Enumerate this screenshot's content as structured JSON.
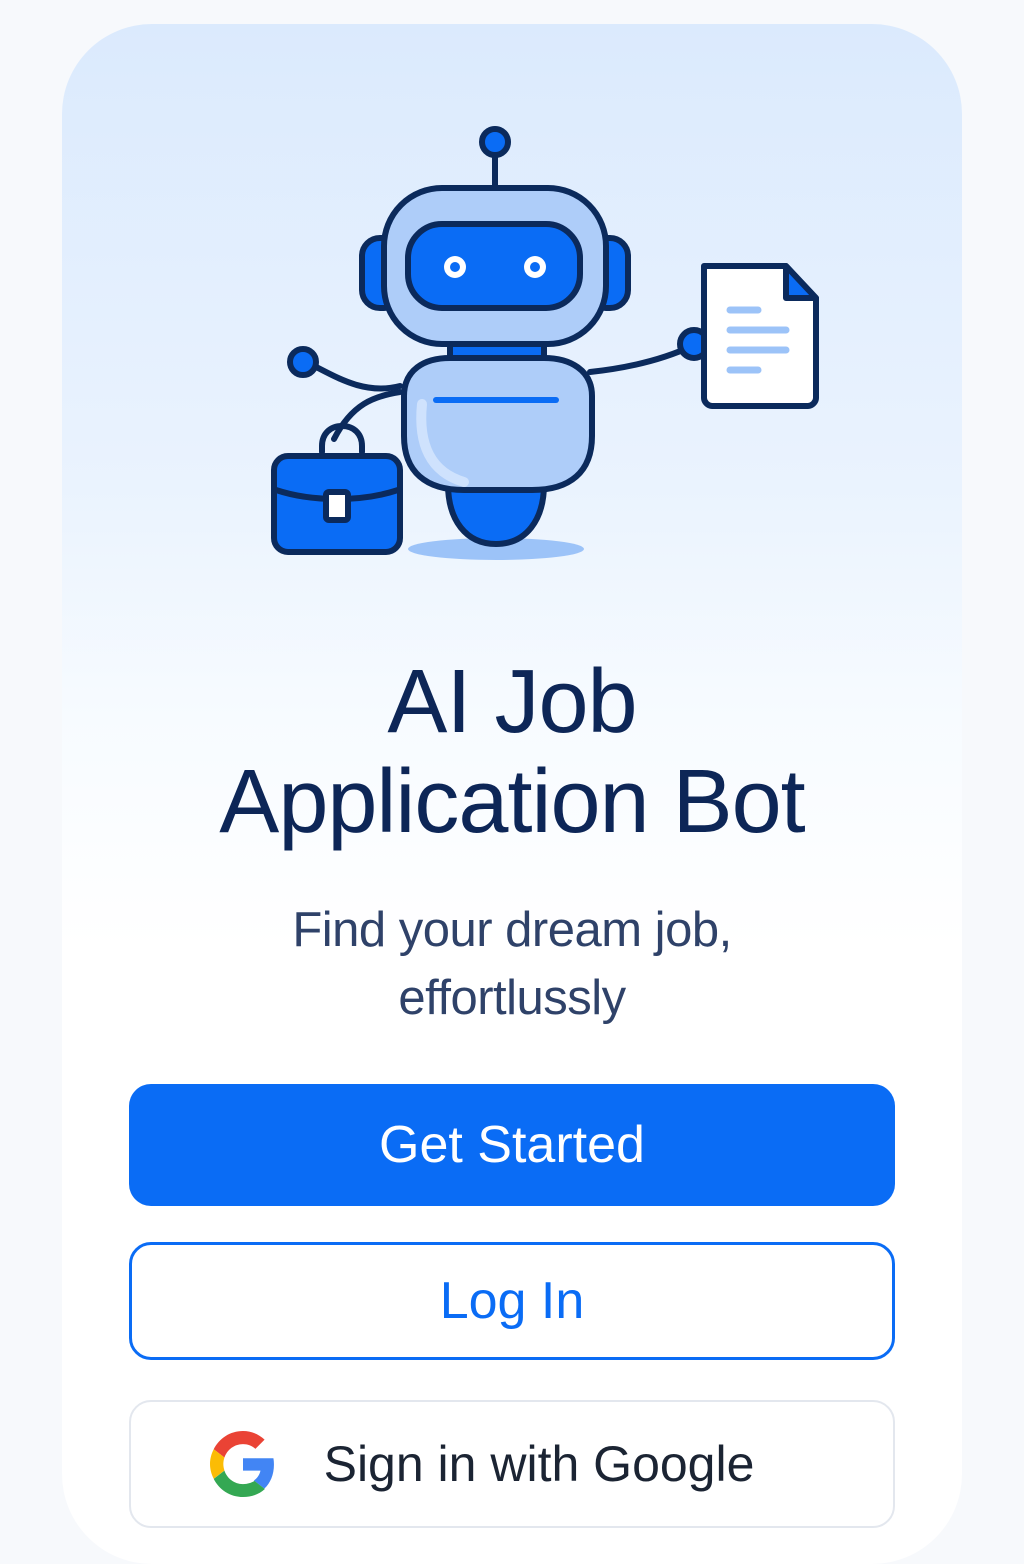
{
  "app": {
    "title_line1": "AI Job",
    "title_line2": "Application Bot",
    "subtitle_line1": "Find your dream job,",
    "subtitle_line2": "effortlussly"
  },
  "actions": {
    "get_started_label": "Get Started",
    "login_label": "Log In",
    "google_label": "Sign in with Google"
  },
  "icons": {
    "hero": "robot-with-briefcase-and-document",
    "google": "google-g-icon"
  },
  "colors": {
    "brand": "#0a6cf5",
    "title": "#0d2657",
    "subtitle": "#2f4269",
    "robot_body": "#aecdf9",
    "robot_outline": "#0b2a5c"
  }
}
